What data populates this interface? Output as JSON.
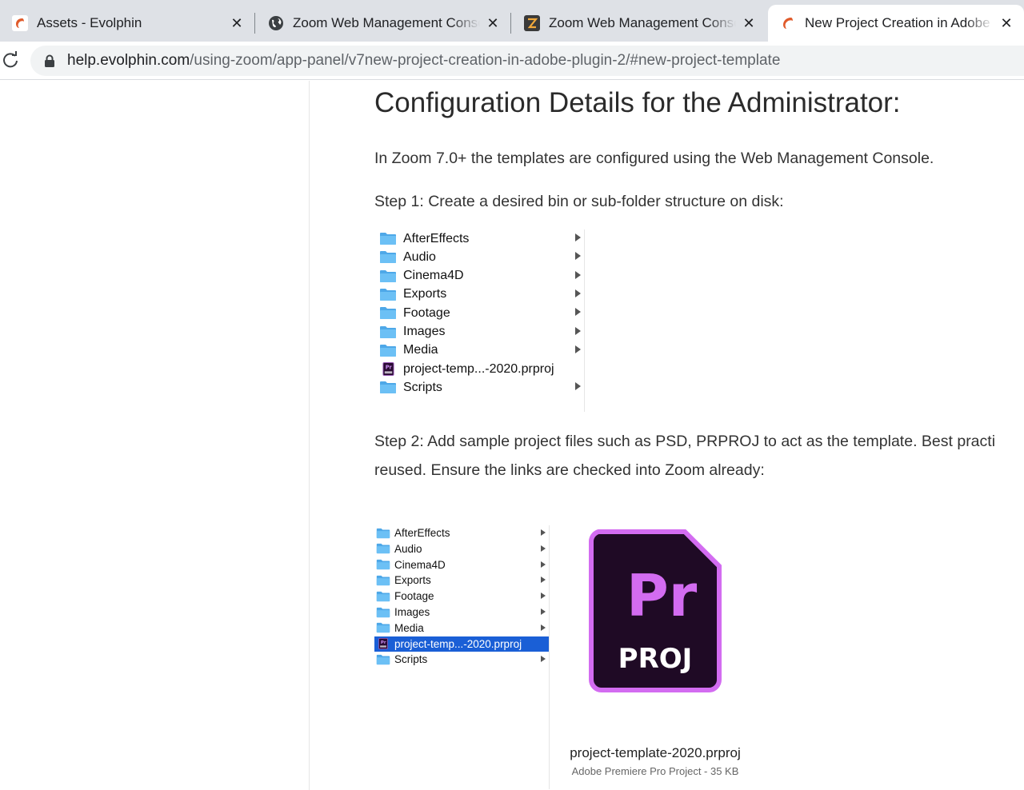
{
  "browser": {
    "tabs": [
      {
        "title": "Assets - Evolphin",
        "icon": "evolphin-icon"
      },
      {
        "title": "Zoom Web Management Console",
        "icon": "globe-icon"
      },
      {
        "title": "Zoom Web Management Console",
        "icon": "zoom-z-icon"
      },
      {
        "title": "New Project Creation in Adobe Plugin",
        "icon": "evolphin-icon",
        "active": true
      }
    ],
    "url_host": "help.evolphin.com",
    "url_path": "/using-zoom/app-panel/v7new-project-creation-in-adobe-plugin-2/#new-project-template"
  },
  "article": {
    "heading": "Configuration Details for the Administrator:",
    "intro": "In Zoom 7.0+ the templates are configured using the Web Management Console.",
    "step1": "Step 1: Create a desired bin or sub-folder structure on disk:",
    "step2_line1": "Step 2: Add sample project files such as PSD, PRPROJ to act as the template. Best practi",
    "step2_line2": "reused. Ensure the links are checked into Zoom already:"
  },
  "finder_list_1": [
    {
      "name": "AfterEffects",
      "type": "folder"
    },
    {
      "name": "Audio",
      "type": "folder"
    },
    {
      "name": "Cinema4D",
      "type": "folder"
    },
    {
      "name": "Exports",
      "type": "folder"
    },
    {
      "name": "Footage",
      "type": "folder"
    },
    {
      "name": "Images",
      "type": "folder"
    },
    {
      "name": "Media",
      "type": "folder"
    },
    {
      "name": "project-temp...-2020.prproj",
      "type": "file"
    },
    {
      "name": "Scripts",
      "type": "folder"
    }
  ],
  "finder_list_2": [
    {
      "name": "AfterEffects",
      "type": "folder"
    },
    {
      "name": "Audio",
      "type": "folder"
    },
    {
      "name": "Cinema4D",
      "type": "folder"
    },
    {
      "name": "Exports",
      "type": "folder"
    },
    {
      "name": "Footage",
      "type": "folder"
    },
    {
      "name": "Images",
      "type": "folder"
    },
    {
      "name": "Media",
      "type": "folder"
    },
    {
      "name": "project-temp...-2020.prproj",
      "type": "file",
      "selected": true
    },
    {
      "name": "Scripts",
      "type": "folder"
    }
  ],
  "preview": {
    "badge_text": "PROJ",
    "badge_letters": "Pr",
    "filename": "project-template-2020.prproj",
    "meta": "Adobe Premiere Pro Project - 35 KB"
  },
  "colors": {
    "folder_blue": "#5db6f0",
    "selection_blue": "#1a5fd6",
    "premiere_purple": "#9999ff",
    "premiere_border": "#d36cf1",
    "premiere_bg": "#1f0a25"
  }
}
